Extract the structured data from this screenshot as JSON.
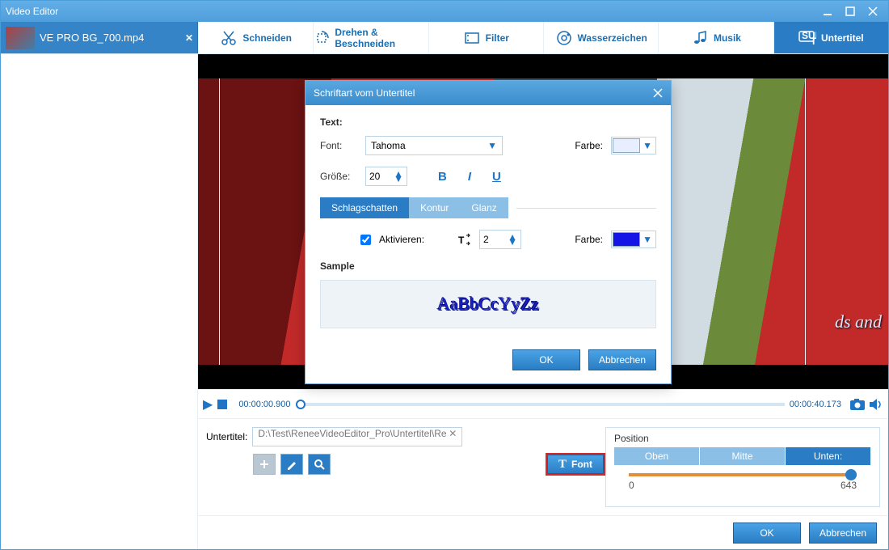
{
  "title": "Video Editor",
  "filetab": {
    "name": "VE PRO BG_700.mp4"
  },
  "tools": [
    {
      "label": "Schneiden",
      "icon": "cut-icon"
    },
    {
      "label": "Drehen & Beschneiden",
      "icon": "rotate-icon"
    },
    {
      "label": "Filter",
      "icon": "filter-icon"
    },
    {
      "label": "Wasserzeichen",
      "icon": "watermark-icon"
    },
    {
      "label": "Musik",
      "icon": "music-icon"
    },
    {
      "label": "Untertitel",
      "icon": "subtitle-icon"
    }
  ],
  "active_tool": 5,
  "preview": {
    "subtitle_overlay": "ds and"
  },
  "transport": {
    "time_start": "00:00:00.900",
    "time_end": "00:00:40.173"
  },
  "subtitle_panel": {
    "label": "Untertitel:",
    "path": "D:\\Test\\ReneeVideoEditor_Pro\\Untertitel\\Re",
    "font_btn": "Font",
    "position": {
      "title": "Position",
      "opts": [
        "Oben",
        "Mitte",
        "Unten:"
      ],
      "selected": 2,
      "min": "0",
      "max": "643"
    }
  },
  "footer": {
    "ok": "OK",
    "cancel": "Abbrechen"
  },
  "dialog": {
    "title": "Schriftart vom Untertitel",
    "text_label": "Text:",
    "font_label": "Font:",
    "font_value": "Tahoma",
    "color_label": "Farbe:",
    "text_color": "#e6eeff",
    "size_label": "Größe:",
    "size_value": "20",
    "tabs": [
      "Schlagschatten",
      "Kontur",
      "Glanz"
    ],
    "tab_selected": 0,
    "activate_label": "Aktivieren:",
    "activate": true,
    "offset_value": "2",
    "eff_color": "#1414e6",
    "sample_label": "Sample",
    "sample_text": "AaBbCcYyZz",
    "ok": "OK",
    "cancel": "Abbrechen"
  }
}
